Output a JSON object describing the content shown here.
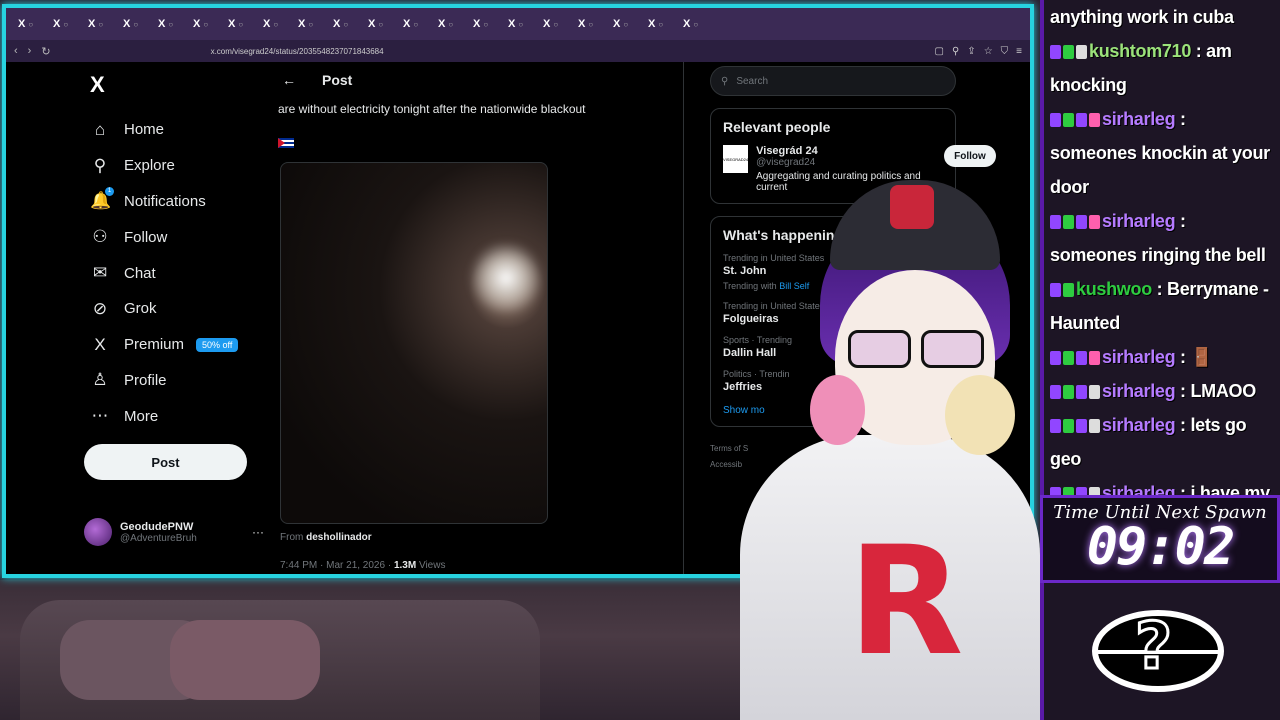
{
  "browser": {
    "url": "x.com/visegrad24/status/2035548237071843684",
    "tab_count": 20
  },
  "nav": {
    "logo": "X",
    "items": [
      {
        "label": "Home",
        "icon": "home-icon",
        "glyph": "⌂"
      },
      {
        "label": "Explore",
        "icon": "search-icon",
        "glyph": "⚲"
      },
      {
        "label": "Notifications",
        "icon": "bell-icon",
        "glyph": "🔔"
      },
      {
        "label": "Follow",
        "icon": "add-person-icon",
        "glyph": "⚇"
      },
      {
        "label": "Chat",
        "icon": "mail-icon",
        "glyph": "✉"
      },
      {
        "label": "Grok",
        "icon": "grok-icon",
        "glyph": "⊘"
      },
      {
        "label": "Premium",
        "icon": "x-icon",
        "glyph": "X"
      },
      {
        "label": "Profile",
        "icon": "person-icon",
        "glyph": "♙"
      },
      {
        "label": "More",
        "icon": "more-icon",
        "glyph": "⋯"
      }
    ],
    "notifications_badge": "1",
    "premium_promo": "50% off",
    "post_button": "Post",
    "account_name": "GeodudePNW",
    "account_handle": "@AdventureBruh",
    "account_more": "···"
  },
  "post": {
    "header": "Post",
    "text": "are without electricity tonight after the nationwide blackout",
    "from_label": "From",
    "from_name": "deshollinador",
    "timestamp": "7:44 PM · Mar 21, 2026 ·",
    "views_count": "1.3M",
    "views_label": "Views"
  },
  "right": {
    "search_placeholder": "Search",
    "relevant_title": "Relevant people",
    "person_name": "Visegrád 24",
    "person_handle": "@visegrad24",
    "person_bio": "Aggregating and curating politics and current",
    "person_logo": "VISEGRAD24",
    "follow_label": "Follow",
    "happening_title": "What's happenin",
    "trends": [
      {
        "context": "Trending in United States",
        "name": "St. John",
        "with_prefix": "Trending with",
        "with_link": "Bill Self"
      },
      {
        "context": "Trending in United State",
        "name": "Folgueiras",
        "with_prefix": "",
        "with_link": ""
      },
      {
        "context": "Sports · Trending",
        "name": "Dallin Hall",
        "with_prefix": "",
        "with_link": ""
      },
      {
        "context": "Politics · Trendin",
        "name": "Jeffries",
        "with_prefix": "",
        "with_link": ""
      }
    ],
    "show_more": "Show mo",
    "footer_1": "Terms of S",
    "footer_2": "Accessib"
  },
  "chat": {
    "messages": [
      {
        "user": "",
        "user_color": "#ffffff",
        "text": "anything work in cuba",
        "badges": []
      },
      {
        "user": "kushtom710",
        "user_color": "#9be27a",
        "text": ": am knocking",
        "badges": [
          "c-purple",
          "c-green",
          "c-white"
        ]
      },
      {
        "user": "sirharleg",
        "user_color": "#b57bff",
        "text": ": someones knockin at your door",
        "badges": [
          "c-purple",
          "c-green",
          "c-purple",
          "c-pink"
        ]
      },
      {
        "user": "sirharleg",
        "user_color": "#b57bff",
        "text": ": someones ringing the bell",
        "badges": [
          "c-purple",
          "c-green",
          "c-purple",
          "c-pink"
        ]
      },
      {
        "user": "kushwoo",
        "user_color": "#2ecc40",
        "text": ": Berrymane - Haunted",
        "badges": [
          "c-purple",
          "c-green"
        ]
      },
      {
        "user": "sirharleg",
        "user_color": "#b57bff",
        "text": ": 🚪",
        "badges": [
          "c-purple",
          "c-green",
          "c-purple",
          "c-pink"
        ]
      },
      {
        "user": "sirharleg",
        "user_color": "#b57bff",
        "text": ": LMAOO",
        "badges": [
          "c-purple",
          "c-green",
          "c-purple",
          "c-white"
        ]
      },
      {
        "user": "sirharleg",
        "user_color": "#b57bff",
        "text": ": lets go geo",
        "badges": [
          "c-purple",
          "c-green",
          "c-purple",
          "c-white"
        ]
      },
      {
        "user": "sirharleg",
        "user_color": "#b57bff",
        "text": ": i have my shark icon back lets go",
        "badges": [
          "c-purple",
          "c-green",
          "c-purple",
          "c-white"
        ]
      }
    ]
  },
  "timer": {
    "label": "Time Until Next Spawn",
    "value": "09:02"
  },
  "colors": {
    "accent_cyan": "#27d3e0",
    "x_blue": "#1d9bf0",
    "chat_border": "#5a1aa8"
  }
}
